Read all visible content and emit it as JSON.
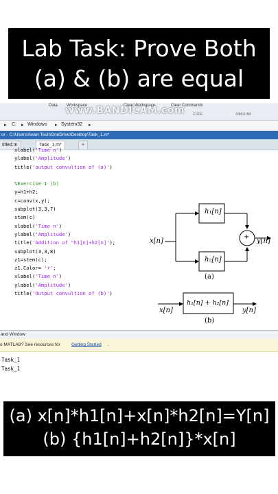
{
  "banner": {
    "line1": "Lab Task: Prove Both",
    "line2": "(a) & (b) are equal"
  },
  "ribbon": {
    "data": "Data",
    "workspace": "Workspace",
    "clear_workspace": "Clear Workspace",
    "clear_commands": "Clear Commands",
    "code": "CODE",
    "simulink": "SIMULINK",
    "watermark": "www.BANDICAM.com"
  },
  "path": {
    "drive": "C:",
    "seg1": "Windows",
    "seg2": "System32"
  },
  "editor": {
    "title": "or - C:\\Users\\Awan Tech\\OneDrive\\Desktop\\Task_1.m*",
    "tab1": "titled.m",
    "tab2": "Task_1.m*",
    "add_tab": "+"
  },
  "code": [
    {
      "pre": "xlabel(",
      "str": "'Time n'",
      "post": ")"
    },
    {
      "pre": "ylabel(",
      "str": "'Amplitude'",
      "post": ")"
    },
    {
      "pre": "title(",
      "str": "'output convultion of (a)'",
      "post": ")"
    },
    {
      "pre": "",
      "str": "",
      "post": ""
    },
    {
      "comment": "%Exercise 1 (b)"
    },
    {
      "pre": "y=h1+h2;",
      "str": "",
      "post": ""
    },
    {
      "pre": "c=conv(x,y);",
      "str": "",
      "post": ""
    },
    {
      "pre": "subplot(3,3,7)",
      "str": "",
      "post": ""
    },
    {
      "pre": "stem(c)",
      "str": "",
      "post": ""
    },
    {
      "pre": "xlabel(",
      "str": "'Time n'",
      "post": ")"
    },
    {
      "pre": "ylabel(",
      "str": "'Amplitude'",
      "post": ")"
    },
    {
      "pre": "title(",
      "str": "'Addition of \"h1[n]+h2[n]'",
      "post": ");"
    },
    {
      "pre": "subplot(3,3,8)",
      "str": "",
      "post": ""
    },
    {
      "pre": "z1=stem(c);",
      "str": "",
      "post": ""
    },
    {
      "pre": "z1.Color= ",
      "str": "'r'",
      "post": ";"
    },
    {
      "pre": "xlabel(",
      "str": "'Time n'",
      "post": ")"
    },
    {
      "pre": "ylabel(",
      "str": "'Amplitude'",
      "post": ")"
    },
    {
      "pre": "title(",
      "str": "'Output convultion of (b)'",
      "post": ")"
    }
  ],
  "command_window": {
    "header": "and Window",
    "info_prefix": "o MATLAB? See resources for ",
    "info_link": "Getting Started",
    "info_suffix": ".",
    "lines": [
      "Task_1",
      "Task_1"
    ]
  },
  "diagram": {
    "h1": "h₁[n]",
    "h2": "h₂[n]",
    "x_a": "x[n]",
    "y_a": "y[n]",
    "label_a": "(a)",
    "sum": "h₁[n] + h₂[n]",
    "x_b": "x[n]",
    "y_b": "y[n]",
    "label_b": "(b)",
    "plus": "+"
  },
  "answer": {
    "line1": "(a) x[n]*h1[n]+x[n]*h2[n]=Y[n]",
    "line2": "(b) {h1[n]+h2[n]}*x[n]"
  }
}
